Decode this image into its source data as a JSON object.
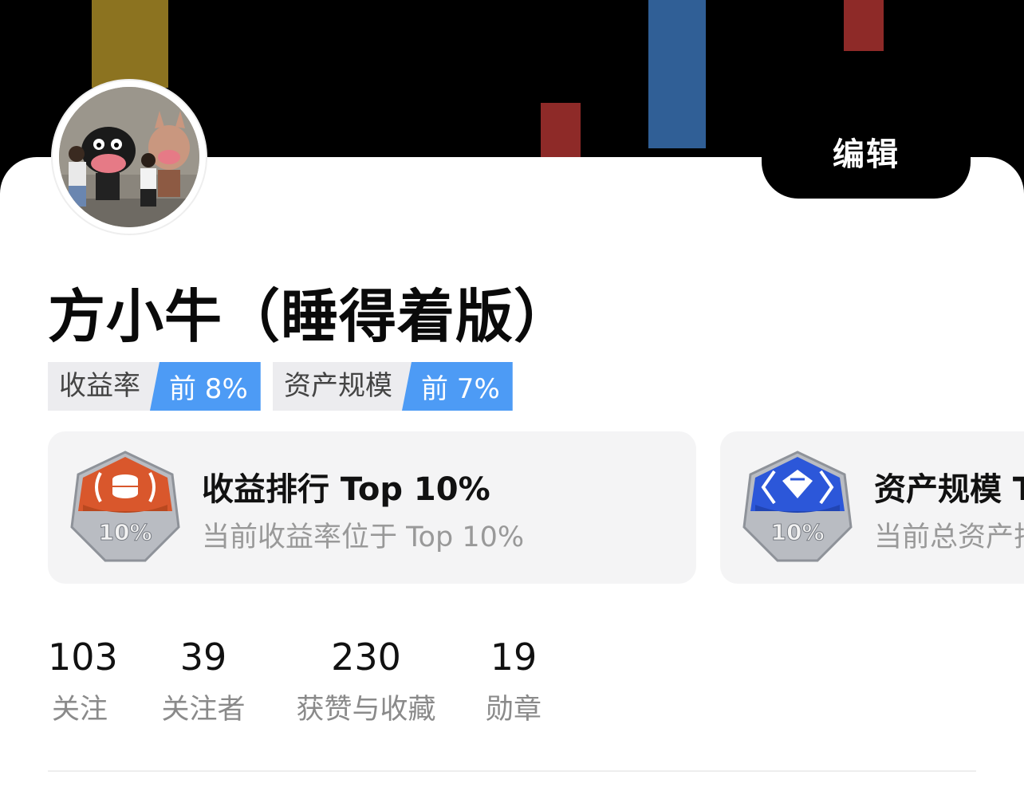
{
  "header": {
    "edit_label": "编辑"
  },
  "profile": {
    "name": "方小牛（睡得着版）",
    "avatar_icon": "avatar-photo"
  },
  "rank_tags": [
    {
      "label": "收益率",
      "value": "前 8%"
    },
    {
      "label": "资产规模",
      "value": "前 7%"
    }
  ],
  "badges": [
    {
      "title": "收益排行 Top 10%",
      "desc": "当前收益率位于 Top 10%",
      "icon": "coin-badge-icon",
      "badge_text": "10%",
      "color": "#d9572c"
    },
    {
      "title": "资产规模 T",
      "desc": "当前总资产排",
      "icon": "diamond-badge-icon",
      "badge_text": "10%",
      "color": "#2c57d9"
    }
  ],
  "stats": [
    {
      "value": "103",
      "label": "关注"
    },
    {
      "value": "39",
      "label": "关注者"
    },
    {
      "value": "230",
      "label": "获赞与收藏"
    },
    {
      "value": "19",
      "label": "勋章"
    }
  ],
  "colors": {
    "accent_blue": "#4d9bf5",
    "banner_gold": "#8c7320",
    "banner_red": "#8e2a28",
    "banner_blue": "#305f96"
  }
}
